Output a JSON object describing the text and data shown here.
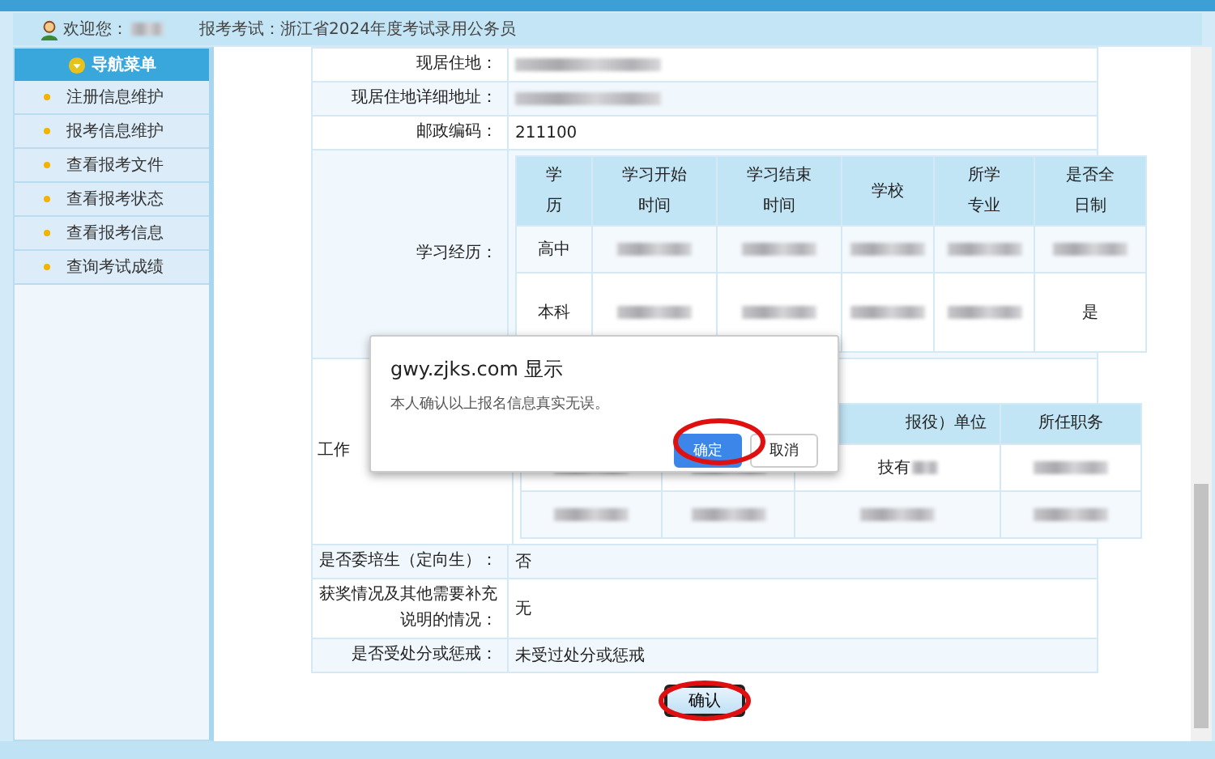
{
  "header": {
    "welcome": "欢迎您：",
    "exam": "报考考试：浙江省2024年度考试录用公务员"
  },
  "sidebar": {
    "title": "导航菜单",
    "items": [
      "注册信息维护",
      "报考信息维护",
      "查看报考文件",
      "查看报考状态",
      "查看报考信息",
      "查询考试成绩"
    ]
  },
  "form": {
    "rows": [
      {
        "kind": "field",
        "label": "现居住地：",
        "value": {
          "kind": "blurred"
        }
      },
      {
        "kind": "field",
        "label": "现居住地详细地址：",
        "value": {
          "kind": "blurred"
        }
      },
      {
        "kind": "field",
        "label": "邮政编码：",
        "value": {
          "kind": "text",
          "text": "211100"
        }
      },
      {
        "kind": "table",
        "label": "学习经历：",
        "headers": [
          "学历",
          "学习开始时间",
          "学习结束时间",
          "学校",
          "所学专业",
          "是否全日制"
        ],
        "rows": [
          [
            {
              "kind": "text",
              "text": "高中"
            },
            {
              "kind": "blurred"
            },
            {
              "kind": "blurred"
            },
            {
              "kind": "blurred"
            },
            {
              "kind": "blurred"
            },
            {
              "kind": "blurred"
            }
          ],
          [
            {
              "kind": "text",
              "text": "本科"
            },
            {
              "kind": "blurred"
            },
            {
              "kind": "blurred"
            },
            {
              "kind": "blurred"
            },
            {
              "kind": "blurred"
            },
            {
              "kind": "text",
              "text": "是"
            }
          ]
        ]
      },
      {
        "kind": "work",
        "label": "工作",
        "headers": [
          "报役）单位",
          "所任职务"
        ],
        "rows": [
          [
            {
              "kind": "blurred"
            },
            {
              "kind": "blurred"
            },
            {
              "kind": "partial",
              "text": "技有"
            },
            {
              "kind": "blurred"
            }
          ],
          [
            {
              "kind": "blurred"
            },
            {
              "kind": "blurred"
            },
            {
              "kind": "blurred"
            },
            {
              "kind": "blurred"
            }
          ]
        ]
      },
      {
        "kind": "field",
        "label": "是否委培生（定向生）：",
        "value": {
          "kind": "text",
          "text": "否"
        }
      },
      {
        "kind": "field",
        "label": "获奖情况及其他需要补充说明的情况：",
        "value": {
          "kind": "text",
          "text": "无"
        }
      },
      {
        "kind": "field",
        "label": "是否受处分或惩戒：",
        "value": {
          "kind": "text",
          "text": "未受过处分或惩戒"
        }
      }
    ]
  },
  "confirm_button": "确认",
  "dialog": {
    "title": "gwy.zjks.com 显示",
    "message": "本人确认以上报名信息真实无误。",
    "buttons": [
      {
        "label": "确定",
        "kind": "primary"
      },
      {
        "label": "取消",
        "kind": "secondary"
      }
    ]
  }
}
